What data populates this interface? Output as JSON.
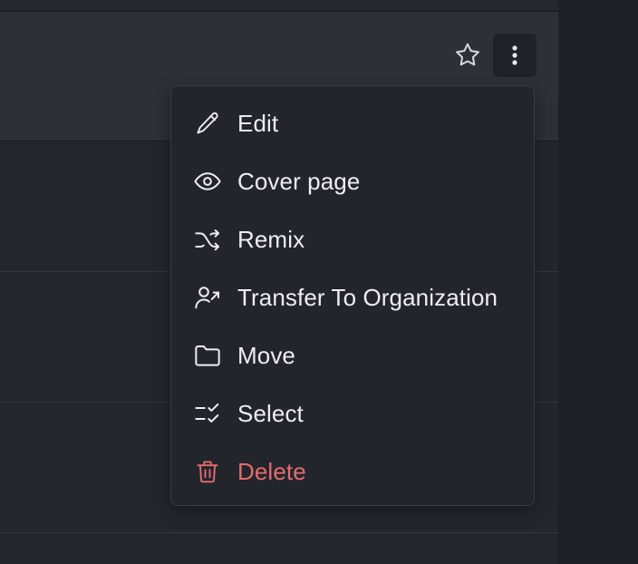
{
  "toolbar": {
    "star_icon": "star-icon",
    "more_icon": "vertical-dots-icon"
  },
  "menu": {
    "items": [
      {
        "label": "Edit",
        "icon": "pencil-icon",
        "color": "#eceef3"
      },
      {
        "label": "Cover page",
        "icon": "eye-icon",
        "color": "#eceef3"
      },
      {
        "label": "Remix",
        "icon": "shuffle-icon",
        "color": "#eceef3"
      },
      {
        "label": "Transfer To Organization",
        "icon": "user-transfer-icon",
        "color": "#eceef3"
      },
      {
        "label": "Move",
        "icon": "folder-icon",
        "color": "#eceef3"
      },
      {
        "label": "Select",
        "icon": "checklist-icon",
        "color": "#eceef3"
      },
      {
        "label": "Delete",
        "icon": "trash-icon",
        "color": "#e26d6d"
      }
    ]
  },
  "colors": {
    "background": "#1e2028",
    "panel": "#24262e",
    "header": "#2e2f37",
    "menu": "#23252d",
    "text": "#eceef3",
    "danger": "#e26d6d"
  }
}
